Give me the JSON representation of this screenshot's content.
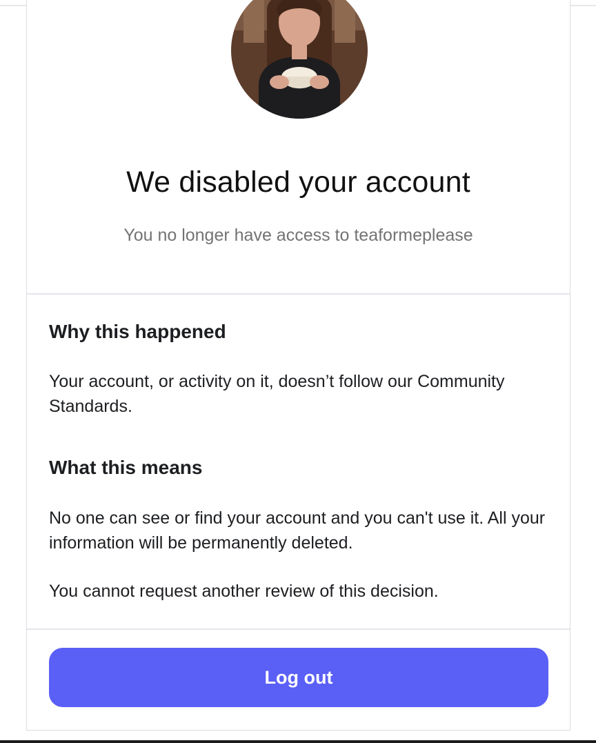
{
  "title": "We disabled your account",
  "subtitle": "You no longer have access to teaformeplease",
  "sections": [
    {
      "heading": "Why this happened",
      "paragraphs": [
        "Your account, or activity on it, doesn’t follow our Community Standards."
      ]
    },
    {
      "heading": "What this means",
      "paragraphs": [
        "No one can see or find your account and you can't use it. All your information will be permanently deleted.",
        "You cannot request another review of this decision."
      ]
    }
  ],
  "logout_label": "Log out",
  "colors": {
    "button": "#5a5ff6",
    "subtitle": "#737373",
    "divider": "#e4e6eb"
  }
}
